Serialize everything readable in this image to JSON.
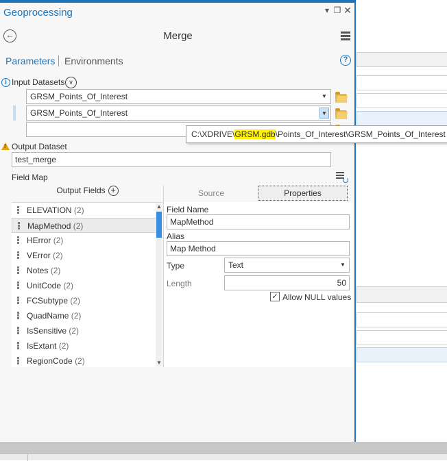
{
  "pane": {
    "title": "Geoprocessing",
    "tool_title": "Merge",
    "tabs": {
      "parameters": "Parameters",
      "environments": "Environments"
    }
  },
  "input": {
    "label": "Input Datasets",
    "rows": [
      "GRSM_Points_Of_Interest",
      "GRSM_Points_Of_Interest",
      ""
    ]
  },
  "tooltip": {
    "prefix": "C:\\XDRIVE\\",
    "highlight": "GRSM.gdb",
    "suffix": "\\Points_Of_Interest\\GRSM_Points_Of_Interest"
  },
  "output": {
    "label": "Output Dataset",
    "value": "test_merge"
  },
  "field_map": {
    "label": "Field Map",
    "output_fields_label": "Output Fields",
    "fields": [
      {
        "name": "ELEVATION",
        "count": "(2)"
      },
      {
        "name": "MapMethod",
        "count": "(2)"
      },
      {
        "name": "HError",
        "count": "(2)"
      },
      {
        "name": "VError",
        "count": "(2)"
      },
      {
        "name": "Notes",
        "count": "(2)"
      },
      {
        "name": "UnitCode",
        "count": "(2)"
      },
      {
        "name": "FCSubtype",
        "count": "(2)"
      },
      {
        "name": "QuadName",
        "count": "(2)"
      },
      {
        "name": "IsSensitive",
        "count": "(2)"
      },
      {
        "name": "IsExtant",
        "count": "(2)"
      },
      {
        "name": "RegionCode",
        "count": "(2)"
      }
    ],
    "tabs": {
      "source": "Source",
      "properties": "Properties"
    },
    "properties": {
      "field_name_label": "Field Name",
      "field_name": "MapMethod",
      "alias_label": "Alias",
      "alias": "Map Method",
      "type_label": "Type",
      "type": "Text",
      "length_label": "Length",
      "length": "50",
      "allow_null_label": "Allow NULL values"
    }
  }
}
